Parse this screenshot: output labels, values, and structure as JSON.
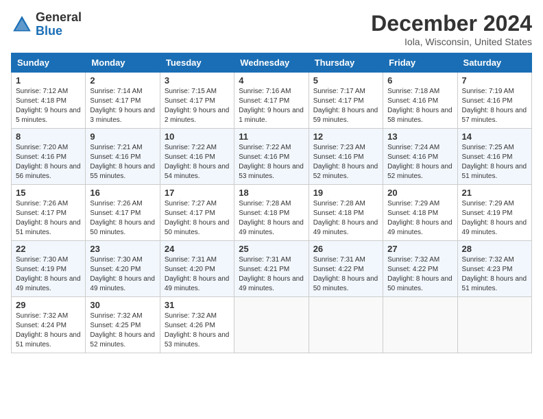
{
  "header": {
    "logo_line1": "General",
    "logo_line2": "Blue",
    "month": "December 2024",
    "location": "Iola, Wisconsin, United States"
  },
  "weekdays": [
    "Sunday",
    "Monday",
    "Tuesday",
    "Wednesday",
    "Thursday",
    "Friday",
    "Saturday"
  ],
  "weeks": [
    [
      {
        "day": "1",
        "sunrise": "Sunrise: 7:12 AM",
        "sunset": "Sunset: 4:18 PM",
        "daylight": "Daylight: 9 hours and 5 minutes."
      },
      {
        "day": "2",
        "sunrise": "Sunrise: 7:14 AM",
        "sunset": "Sunset: 4:17 PM",
        "daylight": "Daylight: 9 hours and 3 minutes."
      },
      {
        "day": "3",
        "sunrise": "Sunrise: 7:15 AM",
        "sunset": "Sunset: 4:17 PM",
        "daylight": "Daylight: 9 hours and 2 minutes."
      },
      {
        "day": "4",
        "sunrise": "Sunrise: 7:16 AM",
        "sunset": "Sunset: 4:17 PM",
        "daylight": "Daylight: 9 hours and 1 minute."
      },
      {
        "day": "5",
        "sunrise": "Sunrise: 7:17 AM",
        "sunset": "Sunset: 4:17 PM",
        "daylight": "Daylight: 8 hours and 59 minutes."
      },
      {
        "day": "6",
        "sunrise": "Sunrise: 7:18 AM",
        "sunset": "Sunset: 4:16 PM",
        "daylight": "Daylight: 8 hours and 58 minutes."
      },
      {
        "day": "7",
        "sunrise": "Sunrise: 7:19 AM",
        "sunset": "Sunset: 4:16 PM",
        "daylight": "Daylight: 8 hours and 57 minutes."
      }
    ],
    [
      {
        "day": "8",
        "sunrise": "Sunrise: 7:20 AM",
        "sunset": "Sunset: 4:16 PM",
        "daylight": "Daylight: 8 hours and 56 minutes."
      },
      {
        "day": "9",
        "sunrise": "Sunrise: 7:21 AM",
        "sunset": "Sunset: 4:16 PM",
        "daylight": "Daylight: 8 hours and 55 minutes."
      },
      {
        "day": "10",
        "sunrise": "Sunrise: 7:22 AM",
        "sunset": "Sunset: 4:16 PM",
        "daylight": "Daylight: 8 hours and 54 minutes."
      },
      {
        "day": "11",
        "sunrise": "Sunrise: 7:22 AM",
        "sunset": "Sunset: 4:16 PM",
        "daylight": "Daylight: 8 hours and 53 minutes."
      },
      {
        "day": "12",
        "sunrise": "Sunrise: 7:23 AM",
        "sunset": "Sunset: 4:16 PM",
        "daylight": "Daylight: 8 hours and 52 minutes."
      },
      {
        "day": "13",
        "sunrise": "Sunrise: 7:24 AM",
        "sunset": "Sunset: 4:16 PM",
        "daylight": "Daylight: 8 hours and 52 minutes."
      },
      {
        "day": "14",
        "sunrise": "Sunrise: 7:25 AM",
        "sunset": "Sunset: 4:16 PM",
        "daylight": "Daylight: 8 hours and 51 minutes."
      }
    ],
    [
      {
        "day": "15",
        "sunrise": "Sunrise: 7:26 AM",
        "sunset": "Sunset: 4:17 PM",
        "daylight": "Daylight: 8 hours and 51 minutes."
      },
      {
        "day": "16",
        "sunrise": "Sunrise: 7:26 AM",
        "sunset": "Sunset: 4:17 PM",
        "daylight": "Daylight: 8 hours and 50 minutes."
      },
      {
        "day": "17",
        "sunrise": "Sunrise: 7:27 AM",
        "sunset": "Sunset: 4:17 PM",
        "daylight": "Daylight: 8 hours and 50 minutes."
      },
      {
        "day": "18",
        "sunrise": "Sunrise: 7:28 AM",
        "sunset": "Sunset: 4:18 PM",
        "daylight": "Daylight: 8 hours and 49 minutes."
      },
      {
        "day": "19",
        "sunrise": "Sunrise: 7:28 AM",
        "sunset": "Sunset: 4:18 PM",
        "daylight": "Daylight: 8 hours and 49 minutes."
      },
      {
        "day": "20",
        "sunrise": "Sunrise: 7:29 AM",
        "sunset": "Sunset: 4:18 PM",
        "daylight": "Daylight: 8 hours and 49 minutes."
      },
      {
        "day": "21",
        "sunrise": "Sunrise: 7:29 AM",
        "sunset": "Sunset: 4:19 PM",
        "daylight": "Daylight: 8 hours and 49 minutes."
      }
    ],
    [
      {
        "day": "22",
        "sunrise": "Sunrise: 7:30 AM",
        "sunset": "Sunset: 4:19 PM",
        "daylight": "Daylight: 8 hours and 49 minutes."
      },
      {
        "day": "23",
        "sunrise": "Sunrise: 7:30 AM",
        "sunset": "Sunset: 4:20 PM",
        "daylight": "Daylight: 8 hours and 49 minutes."
      },
      {
        "day": "24",
        "sunrise": "Sunrise: 7:31 AM",
        "sunset": "Sunset: 4:20 PM",
        "daylight": "Daylight: 8 hours and 49 minutes."
      },
      {
        "day": "25",
        "sunrise": "Sunrise: 7:31 AM",
        "sunset": "Sunset: 4:21 PM",
        "daylight": "Daylight: 8 hours and 49 minutes."
      },
      {
        "day": "26",
        "sunrise": "Sunrise: 7:31 AM",
        "sunset": "Sunset: 4:22 PM",
        "daylight": "Daylight: 8 hours and 50 minutes."
      },
      {
        "day": "27",
        "sunrise": "Sunrise: 7:32 AM",
        "sunset": "Sunset: 4:22 PM",
        "daylight": "Daylight: 8 hours and 50 minutes."
      },
      {
        "day": "28",
        "sunrise": "Sunrise: 7:32 AM",
        "sunset": "Sunset: 4:23 PM",
        "daylight": "Daylight: 8 hours and 51 minutes."
      }
    ],
    [
      {
        "day": "29",
        "sunrise": "Sunrise: 7:32 AM",
        "sunset": "Sunset: 4:24 PM",
        "daylight": "Daylight: 8 hours and 51 minutes."
      },
      {
        "day": "30",
        "sunrise": "Sunrise: 7:32 AM",
        "sunset": "Sunset: 4:25 PM",
        "daylight": "Daylight: 8 hours and 52 minutes."
      },
      {
        "day": "31",
        "sunrise": "Sunrise: 7:32 AM",
        "sunset": "Sunset: 4:26 PM",
        "daylight": "Daylight: 8 hours and 53 minutes."
      },
      null,
      null,
      null,
      null
    ]
  ]
}
